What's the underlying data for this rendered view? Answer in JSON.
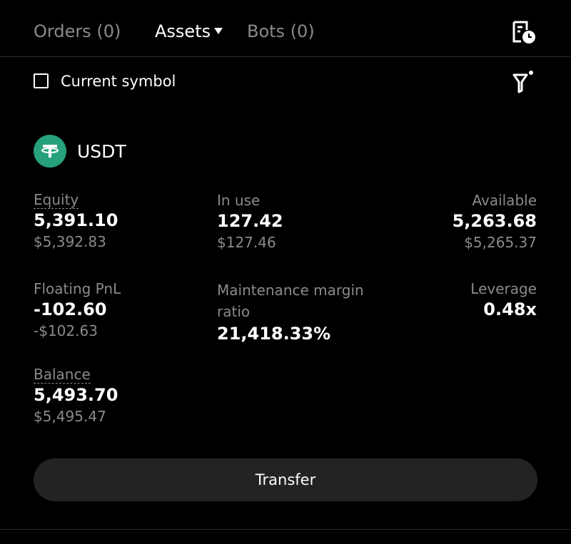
{
  "tabs": {
    "orders": "Orders (0)",
    "assets": "Assets",
    "bots": "Bots (0)"
  },
  "icons": {
    "history": "history-clock-icon",
    "filter": "filter-icon",
    "coin": "tether-icon",
    "caret": "caret-down-icon"
  },
  "filter": {
    "checkbox_label": "Current symbol",
    "checked": false
  },
  "asset": {
    "symbol": "USDT",
    "logo_color": "#26a17b"
  },
  "metrics": {
    "equity": {
      "label": "Equity",
      "value": "5,391.10",
      "usd": "$5,392.83"
    },
    "in_use": {
      "label": "In use",
      "value": "127.42",
      "usd": "$127.46"
    },
    "available": {
      "label": "Available",
      "value": "5,263.68",
      "usd": "$5,265.37"
    },
    "floating_pnl": {
      "label": "Floating PnL",
      "value": "-102.60",
      "usd": "-$102.63"
    },
    "maintenance_margin_ratio": {
      "label": "Maintenance margin ratio",
      "value": "21,418.33%"
    },
    "leverage": {
      "label": "Leverage",
      "value": "0.48x"
    },
    "balance": {
      "label": "Balance",
      "value": "5,493.70",
      "usd": "$5,495.47"
    }
  },
  "actions": {
    "transfer": "Transfer"
  },
  "colors": {
    "background": "#000000",
    "muted_text": "#8a8a8a",
    "button_bg": "#232323"
  }
}
